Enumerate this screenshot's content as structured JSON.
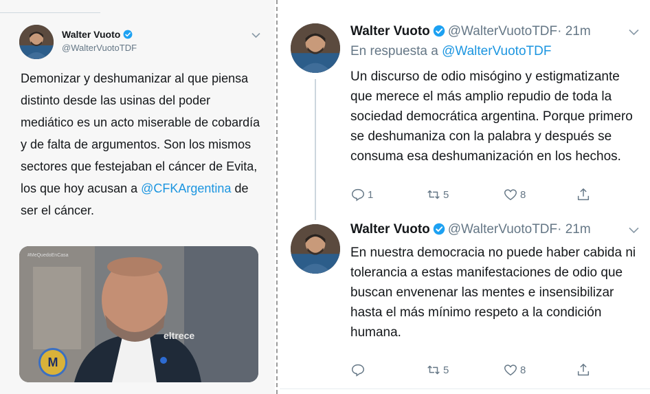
{
  "left_tweet": {
    "author_name": "Walter Vuoto",
    "author_handle": "@WalterVuotoTDF",
    "text_before": "Demonizar y deshumanizar al que piensa distinto desde las usinas del poder mediático es un acto miserable de cobardía y de falta de argumentos. Son los mismos sectores que festejaban el cáncer de Evita, los que hoy acusan a ",
    "mention": "@CFKArgentina",
    "text_after": " de ser el cáncer.",
    "media": {
      "hashtag_overlay": "#MeQuedoEnCasa",
      "channel_logo": "eltrece",
      "show_logo": "M"
    }
  },
  "right_tweets": [
    {
      "author_name": "Walter Vuoto",
      "author_handle": "@WalterVuotoTDF",
      "time": "· 21m",
      "reply_label": "En respuesta a",
      "reply_to": "@WalterVuotoTDF",
      "text": "Un discurso de odio misógino y estigmatizante  que merece el más amplio repudio de toda la sociedad democrática argentina. Porque primero se deshumaniza con la palabra y después se consuma esa deshumanización en los hechos.",
      "replies": "1",
      "retweets": "5",
      "likes": "8"
    },
    {
      "author_name": "Walter Vuoto",
      "author_handle": "@WalterVuotoTDF",
      "time": "· 21m",
      "text": "En nuestra democracia no puede haber cabida ni tolerancia a estas manifestaciones de odio que buscan envenenar las mentes e insensibilizar hasta el más mínimo respeto a la condición humana.",
      "replies": "",
      "retweets": "5",
      "likes": "8"
    }
  ],
  "icons": {
    "verified": "verified-badge-icon",
    "chevron": "chevron-down-icon",
    "reply": "reply-icon",
    "retweet": "retweet-icon",
    "like": "heart-icon",
    "share": "share-icon"
  },
  "colors": {
    "link": "#1b95e0",
    "secondary_text": "#657786",
    "verified": "#1da1f2"
  }
}
